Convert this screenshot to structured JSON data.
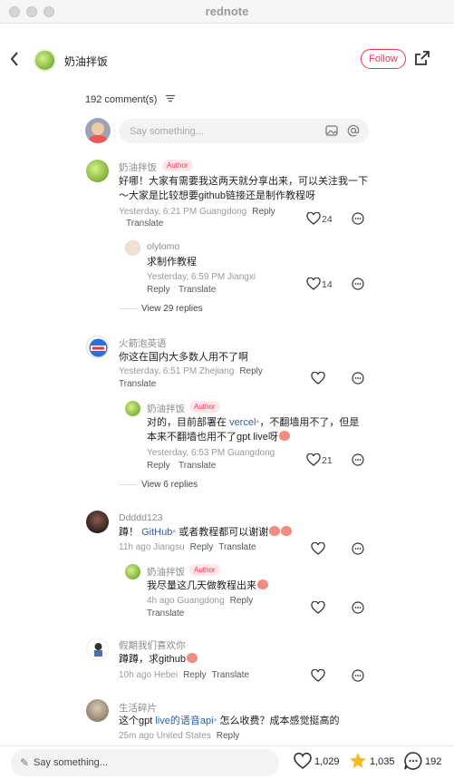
{
  "app": {
    "title": "rednote"
  },
  "header": {
    "back_icon": "chevron-left-icon",
    "author": "奶油拌饭",
    "follow_label": "Follow",
    "share_icon": "share-icon"
  },
  "comments_header": {
    "count": "192 comment(s)",
    "sort_icon": "sort-icon",
    "input_placeholder": "Say something..."
  },
  "comments": [
    {
      "name": "奶油拌饭",
      "tag": "Author",
      "text": "好哪！大家有需要我这两天就分享出来，可以关注我一下～大家是比较想要github链接还是制作教程呀",
      "meta": "Yesterday, 6:21 PM Guangdong",
      "reply": "Reply",
      "translate": "Translate",
      "likes": "24"
    },
    {
      "name": "olylomo",
      "text": "求制作教程",
      "meta": "Yesterday, 6:59 PM Jiangxi",
      "reply": "Reply",
      "translate": "Translate",
      "likes": "14"
    },
    {
      "view": "View 29 replies"
    },
    {
      "name": "火箭泡英语",
      "text": "你这在国内大多数人用不了啊",
      "meta": "Yesterday, 6:51 PM Zhejiang",
      "reply": "Reply",
      "translate": "Translate"
    },
    {
      "name": "奶油拌饭",
      "tag": "Author",
      "text_a": "对的，目前部署在",
      "link": "vercel",
      "text_b": "，不翻墙用不了，但是本来不翻墙也用不了gpt live呀",
      "meta": "Yesterday, 6:53 PM Guangdong",
      "reply": "Reply",
      "translate": "Translate",
      "likes": "21"
    },
    {
      "view": "View 6 replies"
    },
    {
      "name": "Ddddd123",
      "text_a": "蹲！",
      "link": "GitHub",
      "text_b": "或者教程都可以谢谢",
      "meta": "11h ago Jiangsu",
      "reply": "Reply",
      "translate": "Translate"
    },
    {
      "name": "奶油拌饭",
      "tag": "Author",
      "text": "我尽量这几天做教程出来",
      "meta": "4h ago Guangdong",
      "reply": "Reply",
      "translate": "Translate"
    },
    {
      "name": "假期我们喜欢你",
      "text": "蹲蹲，求github",
      "meta": "10h ago Hebei",
      "reply": "Reply",
      "translate": "Translate"
    },
    {
      "name": "生活碎片",
      "text_a": "这个gpt",
      "link": "live的语音api",
      "text_b": "怎么收费？成本感觉挺高的",
      "meta": "25m ago United States",
      "reply": "Reply"
    }
  ],
  "bottom": {
    "placeholder": "Say something...",
    "likes": "1,029",
    "stars": "1,035",
    "comments": "192"
  }
}
